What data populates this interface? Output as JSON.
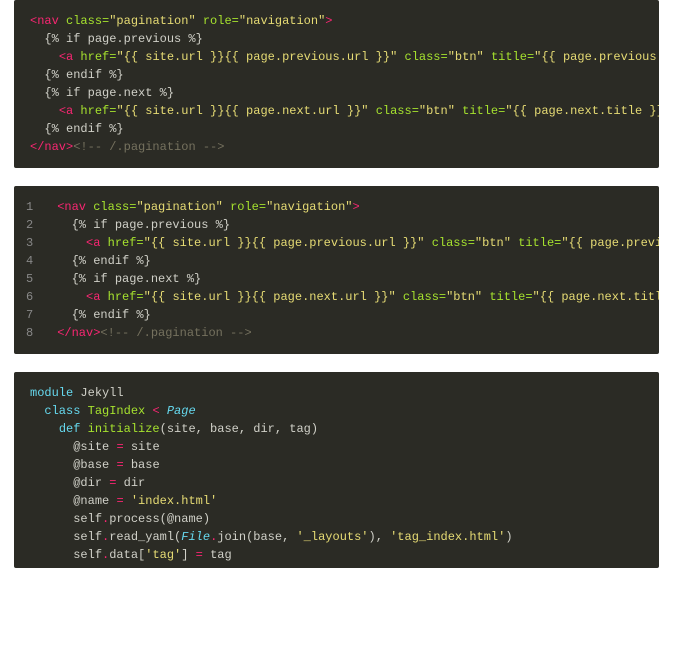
{
  "block1": {
    "lines": [
      {
        "indent": 0,
        "html": "<span class='tag'>&lt;nav</span> <span class='attr'>class=</span><span class='str'>\"pagination\"</span> <span class='attr'>role=</span><span class='str'>\"navigation\"</span><span class='tag'>&gt;</span>"
      },
      {
        "indent": 2,
        "html": "<span class='txt'>{% if page.previous %}</span>"
      },
      {
        "indent": 4,
        "html": "<span class='tag'>&lt;a</span> <span class='attr'>href=</span><span class='str'>\"{{ site.url }}{{ page.previous.url }}\"</span> <span class='attr'>class=</span><span class='str'>\"btn\"</span> <span class='attr'>title=</span><span class='str'>\"{{ page.previous.title }}\"</span><span class='tag'>&gt;</span>"
      },
      {
        "indent": 2,
        "html": "<span class='txt'>{% endif %}</span>"
      },
      {
        "indent": 2,
        "html": "<span class='txt'>{% if page.next %}</span>"
      },
      {
        "indent": 4,
        "html": "<span class='tag'>&lt;a</span> <span class='attr'>href=</span><span class='str'>\"{{ site.url }}{{ page.next.url }}\"</span> <span class='attr'>class=</span><span class='str'>\"btn\"</span> <span class='attr'>title=</span><span class='str'>\"{{ page.next.title }}\"</span><span class='tag'>&gt;</span><span class='txt'>Next</span>"
      },
      {
        "indent": 2,
        "html": "<span class='txt'>{% endif %}</span>"
      },
      {
        "indent": 0,
        "html": "<span class='tag'>&lt;/nav&gt;</span><span class='comment'>&lt;!-- /.pagination --&gt;</span>"
      }
    ]
  },
  "block2": {
    "linenos": [
      "1",
      "2",
      "3",
      "4",
      "5",
      "6",
      "7",
      "8"
    ],
    "lines": [
      {
        "indent": 0,
        "html": "<span class='tag'>&lt;nav</span> <span class='attr'>class=</span><span class='str'>\"pagination\"</span> <span class='attr'>role=</span><span class='str'>\"navigation\"</span><span class='tag'>&gt;</span>"
      },
      {
        "indent": 2,
        "html": "<span class='txt'>{% if page.previous %}</span>"
      },
      {
        "indent": 4,
        "html": "<span class='tag'>&lt;a</span> <span class='attr'>href=</span><span class='str'>\"{{ site.url }}{{ page.previous.url }}\"</span> <span class='attr'>class=</span><span class='str'>\"btn\"</span> <span class='attr'>title=</span><span class='str'>\"{{ page.previous.title }}\"</span>"
      },
      {
        "indent": 2,
        "html": "<span class='txt'>{% endif %}</span>"
      },
      {
        "indent": 2,
        "html": "<span class='txt'>{% if page.next %}</span>"
      },
      {
        "indent": 4,
        "html": "<span class='tag'>&lt;a</span> <span class='attr'>href=</span><span class='str'>\"{{ site.url }}{{ page.next.url }}\"</span> <span class='attr'>class=</span><span class='str'>\"btn\"</span> <span class='attr'>title=</span><span class='str'>\"{{ page.next.title }}\"</span>"
      },
      {
        "indent": 2,
        "html": "<span class='txt'>{% endif %}</span>"
      },
      {
        "indent": 0,
        "html": "<span class='tag'>&lt;/nav&gt;</span><span class='comment'>&lt;!-- /.pagination --&gt;</span>"
      }
    ]
  },
  "block3": {
    "lines": [
      {
        "indent": 0,
        "html": "<span class='kw'>module</span> <span class='nm'>Jekyll</span>"
      },
      {
        "indent": 2,
        "html": "<span class='kw'>class</span> <span class='cls'>TagIndex</span> <span class='op'>&lt;</span> <span class='const'>Page</span>"
      },
      {
        "indent": 4,
        "html": "<span class='kw'>def</span> <span class='fnname'>initialize</span><span class='nm'>(site, base, dir, tag)</span>"
      },
      {
        "indent": 6,
        "html": "<span class='ivar'>@site</span> <span class='op'>=</span> <span class='nm'>site</span>"
      },
      {
        "indent": 6,
        "html": "<span class='ivar'>@base</span> <span class='op'>=</span> <span class='nm'>base</span>"
      },
      {
        "indent": 6,
        "html": "<span class='ivar'>@dir</span> <span class='op'>=</span> <span class='nm'>dir</span>"
      },
      {
        "indent": 6,
        "html": "<span class='ivar'>@name</span> <span class='op'>=</span> <span class='lit'>'index.html'</span>"
      },
      {
        "indent": 6,
        "html": "<span class='nm'>self</span><span class='op'>.</span><span class='nm'>process(</span><span class='ivar'>@name</span><span class='nm'>)</span>"
      },
      {
        "indent": 6,
        "html": "<span class='nm'>self</span><span class='op'>.</span><span class='nm'>read_yaml(</span><span class='const'>File</span><span class='op'>.</span><span class='nm'>join(base, </span><span class='lit'>'_layouts'</span><span class='nm'>), </span><span class='lit'>'tag_index.html'</span><span class='nm'>)</span>"
      },
      {
        "indent": 6,
        "html": "<span class='nm'>self</span><span class='op'>.</span><span class='nm'>data[</span><span class='lit'>'tag'</span><span class='nm'>]</span> <span class='op'>=</span> <span class='nm'>tag</span>"
      }
    ]
  }
}
